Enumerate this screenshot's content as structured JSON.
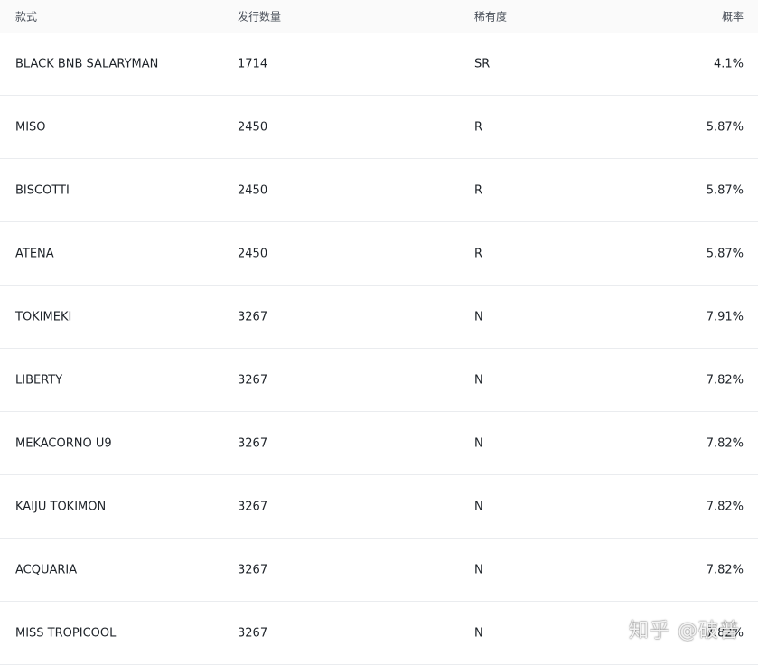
{
  "table": {
    "headers": {
      "name": "款式",
      "supply": "发行数量",
      "rarity": "稀有度",
      "probability": "概率"
    },
    "rows": [
      {
        "name": "BLACK BNB SALARYMAN",
        "supply": "1714",
        "rarity": "SR",
        "probability": "4.1%"
      },
      {
        "name": "MISO",
        "supply": "2450",
        "rarity": "R",
        "probability": "5.87%"
      },
      {
        "name": "BISCOTTI",
        "supply": "2450",
        "rarity": "R",
        "probability": "5.87%"
      },
      {
        "name": "ATENA",
        "supply": "2450",
        "rarity": "R",
        "probability": "5.87%"
      },
      {
        "name": "TOKIMEKI",
        "supply": "3267",
        "rarity": "N",
        "probability": "7.91%"
      },
      {
        "name": "LIBERTY",
        "supply": "3267",
        "rarity": "N",
        "probability": "7.82%"
      },
      {
        "name": "MEKACORNO U9",
        "supply": "3267",
        "rarity": "N",
        "probability": "7.82%"
      },
      {
        "name": "KAIJU TOKIMON",
        "supply": "3267",
        "rarity": "N",
        "probability": "7.82%"
      },
      {
        "name": "ACQUARIA",
        "supply": "3267",
        "rarity": "N",
        "probability": "7.82%"
      },
      {
        "name": "MISS TROPICOOL",
        "supply": "3267",
        "rarity": "N",
        "probability": "7.82%"
      }
    ]
  },
  "watermark": {
    "text": "知乎 @破普"
  }
}
